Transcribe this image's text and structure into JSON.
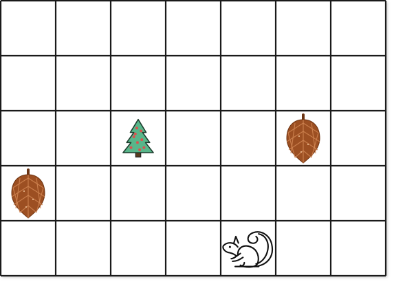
{
  "board": {
    "rows": 5,
    "cols": 7,
    "line_color": "#1a1a1a",
    "background_color": "#ffffff"
  },
  "pieces": [
    {
      "type": "pine-tree",
      "row": 2,
      "col": 2
    },
    {
      "type": "pinecone",
      "row": 2,
      "col": 5
    },
    {
      "type": "pinecone",
      "row": 3,
      "col": 0
    },
    {
      "type": "squirrel",
      "row": 4,
      "col": 4
    }
  ],
  "colors": {
    "tree_green": "#58b68a",
    "tree_ornament": "#d9534f",
    "tree_trunk": "#5a3a1e",
    "cone_body": "#9c4f22",
    "cone_scale": "#d08552",
    "cone_stem": "#6b3414",
    "squirrel_line": "#111111"
  }
}
